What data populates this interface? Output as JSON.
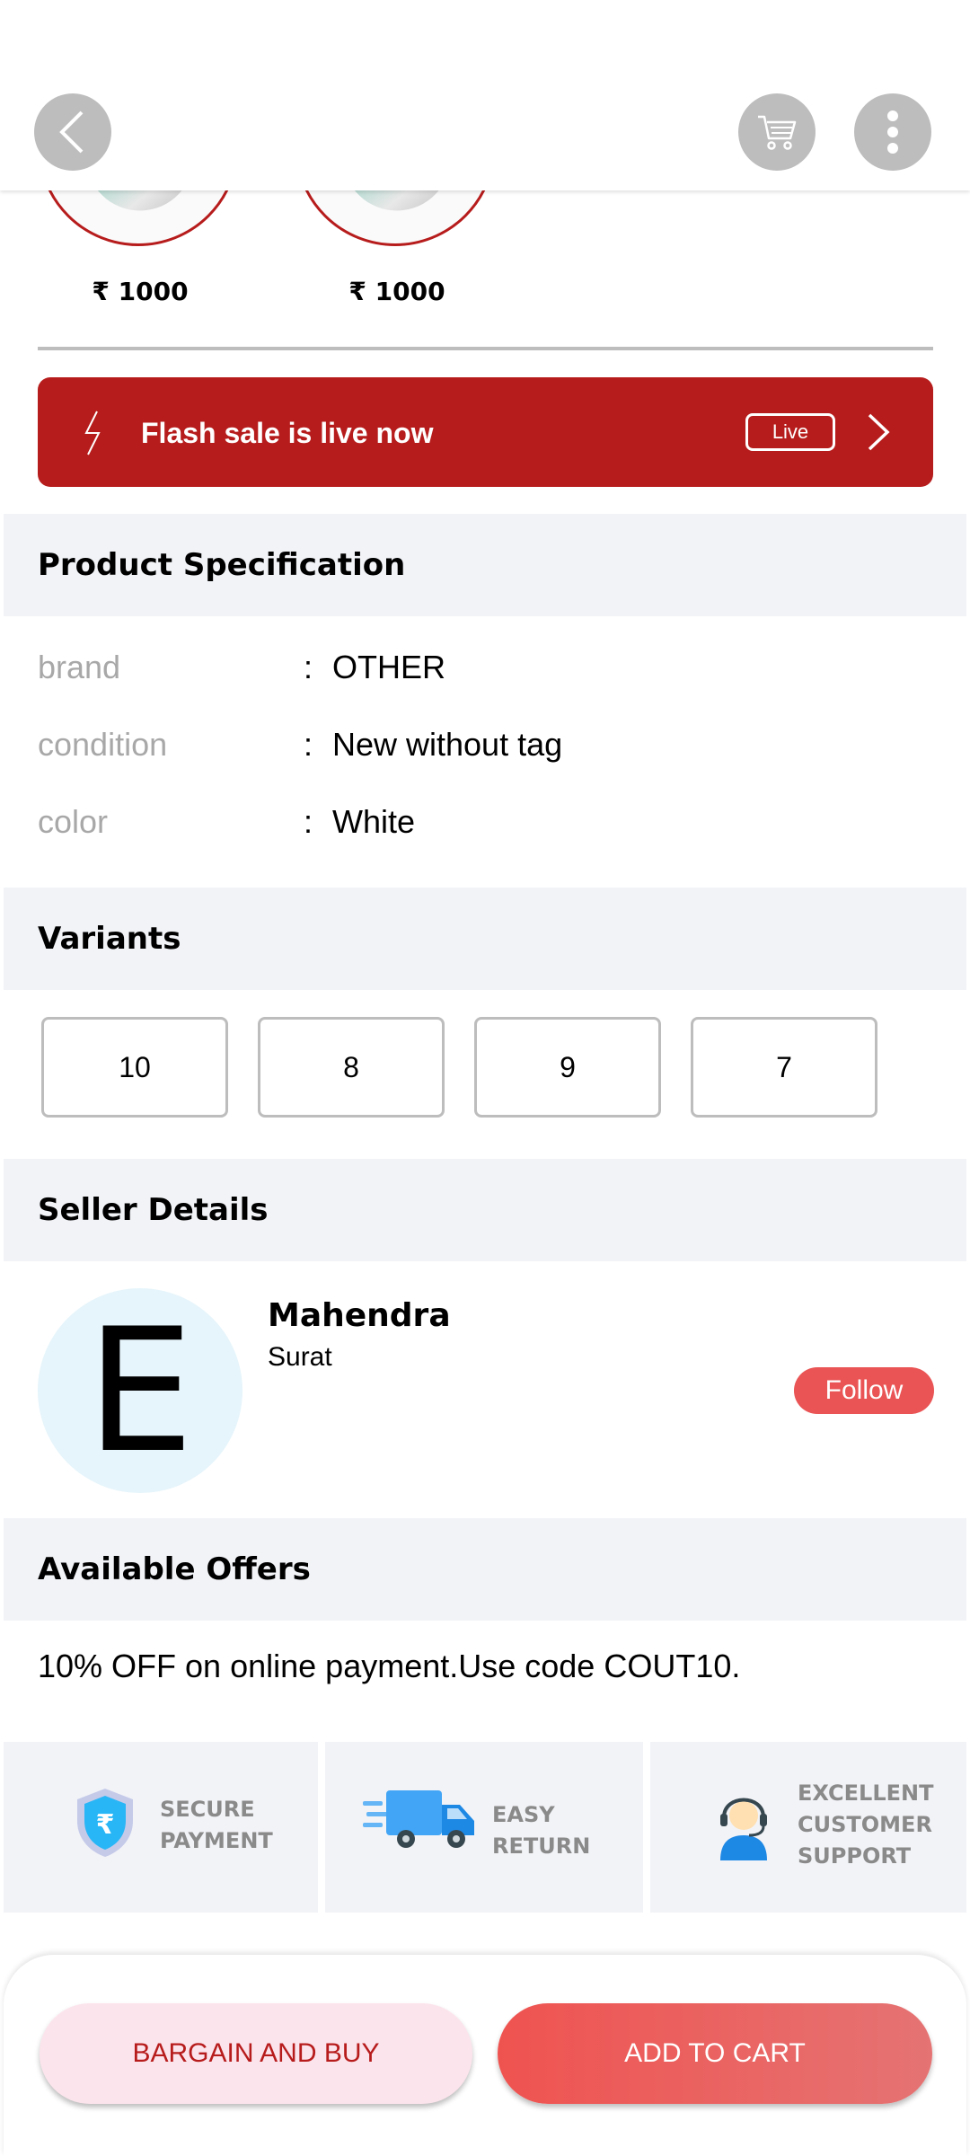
{
  "header": {
    "back_icon": "chevron-left-icon",
    "cart_icon": "cart-icon",
    "more_icon": "more-vertical-icon"
  },
  "similar_products": [
    {
      "price": "₹ 1000"
    },
    {
      "price": "₹ 1000"
    }
  ],
  "flash_sale": {
    "text": "Flash sale is live now",
    "badge": "Live",
    "accent": "#b71c1c"
  },
  "specification": {
    "title": "Product Specification",
    "rows": [
      {
        "label": "brand",
        "value": "OTHER"
      },
      {
        "label": "condition",
        "value": "New without tag"
      },
      {
        "label": "color",
        "value": "White"
      }
    ]
  },
  "variants": {
    "title": "Variants",
    "options": [
      "10",
      "8",
      "9",
      "7"
    ]
  },
  "seller": {
    "title": "Seller Details",
    "initial": "E",
    "name": "Mahendra",
    "location": "Surat",
    "follow_label": "Follow"
  },
  "offers": {
    "title": "Available Offers",
    "text": "10% OFF on online payment.Use code COUT10."
  },
  "features": [
    {
      "icon": "secure-payment-shield-icon",
      "line1": "SECURE",
      "line2": "PAYMENT",
      "line3": ""
    },
    {
      "icon": "delivery-truck-icon",
      "line1": "EASY",
      "line2": "RETURN",
      "line3": ""
    },
    {
      "icon": "customer-support-icon",
      "line1": "EXCELLENT",
      "line2": "CUSTOMER",
      "line3": "SUPPORT"
    }
  ],
  "actions": {
    "bargain_label": "BARGAIN AND BUY",
    "add_to_cart_label": "ADD TO CART"
  },
  "colors": {
    "primary_red": "#b71c1c",
    "button_red": "#ea5455",
    "section_bg": "#f2f3f7"
  }
}
